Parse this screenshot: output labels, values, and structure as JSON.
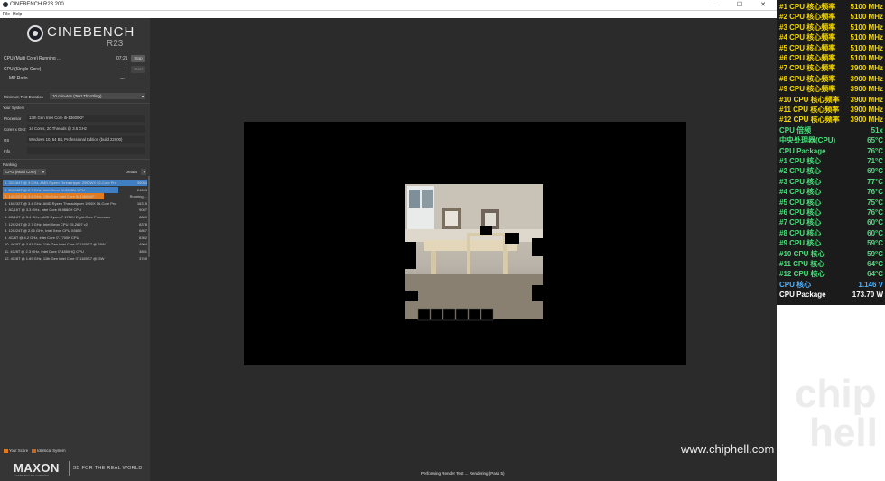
{
  "window": {
    "title": "CINEBENCH R23.200",
    "controls": [
      "—",
      "☐",
      "✕"
    ]
  },
  "menu": [
    "File",
    "Help"
  ],
  "branding": {
    "name": "CINEBENCH",
    "version": "R23"
  },
  "tests": {
    "multi": {
      "label": "CPU (Multi Core)",
      "status": "Running ...",
      "time": "07:21",
      "button": "Stop"
    },
    "single": {
      "label": "CPU (Single Core)",
      "value": "---",
      "button": "Start"
    },
    "mp_ratio": {
      "label": "MP Ratio",
      "value": "---"
    }
  },
  "settings": {
    "min_duration_label": "Minimum Test Duration",
    "min_duration_value": "10 minutes (Test Throttling)"
  },
  "system": {
    "heading": "Your System",
    "fields": [
      {
        "label": "Processor",
        "value": "13th Gen Intel Core i5-13600KF"
      },
      {
        "label": "Cores x GHz",
        "value": "14 Cores, 20 Threads @ 3.5 GHz"
      },
      {
        "label": "OS",
        "value": "Windows 10, 64 Bit, Professional Edition (build 22000)"
      },
      {
        "label": "Info",
        "value": ""
      }
    ]
  },
  "ranking": {
    "heading": "Ranking",
    "selector": "CPU (Multi Core)",
    "details": "Details",
    "rows": [
      {
        "label": "1. 32C/64T @ 3 GHz, AMD Ryzen Threadripper 2990WX 32-Core Pro",
        "score": "30054",
        "fill": 1.0,
        "type": "ref"
      },
      {
        "label": "2. 24C/48T @ 2.7 GHz, Intel Xeon W-3265M CPU",
        "score": "24243",
        "fill": 0.8,
        "type": "ref"
      },
      {
        "label": "3. 14C/20T @ 3.5 GHz, 13th Gen Intel Core i5-13600KF",
        "score": "Running ...",
        "fill": 0.7,
        "type": "yours"
      },
      {
        "label": "4. 16C/32T @ 3.4 GHz, AMD Ryzen Threadripper 1950X 16-Core Pro",
        "score": "16315",
        "fill": 0.0,
        "type": "ref"
      },
      {
        "label": "5. 8C/16T @ 3.3 GHz, Intel Core i9-9880H CPU",
        "score": "9087",
        "fill": 0.0,
        "type": "ref"
      },
      {
        "label": "6. 8C/16T @ 3.4 GHz, AMD Ryzen 7 1700X Eight-Core Processor",
        "score": "8889",
        "fill": 0.0,
        "type": "ref"
      },
      {
        "label": "7. 12C/24T @ 2.7 GHz, Intel Xeon CPU E5-2697 v2",
        "score": "8378",
        "fill": 0.0,
        "type": "ref"
      },
      {
        "label": "8. 12C/24T @ 2.66 GHz, Intel Xeon CPU X5650",
        "score": "6867",
        "fill": 0.0,
        "type": "ref"
      },
      {
        "label": "9. 4C/8T @ 4.2 GHz, Intel Core i7-7700K CPU",
        "score": "6302",
        "fill": 0.0,
        "type": "ref"
      },
      {
        "label": "10. 4C/8T @ 2.81 GHz, 11th Gen Intel Core i7-1165G7 @ 28W",
        "score": "4904",
        "fill": 0.0,
        "type": "ref"
      },
      {
        "label": "11. 4C/8T @ 2.3 GHz, Intel Core i7-4850HQ CPU",
        "score": "3891",
        "fill": 0.0,
        "type": "ref"
      },
      {
        "label": "12. 4C/8T @ 1.69 GHz, 11th Gen Intel Core i7-1165G7 @15W",
        "score": "3769",
        "fill": 0.0,
        "type": "ref"
      }
    ]
  },
  "legend": {
    "your_score": "Your Score",
    "identical": "Identical System"
  },
  "footer": {
    "maxon": "MAXON",
    "maxon_sub": "A NEMETSCHEK COMPANY",
    "tagline": "3D FOR THE REAL WORLD"
  },
  "status": "Performing Render Test ... Rendering (Pass 5)",
  "hwinfo": [
    {
      "k": "#1 CPU 核心频率",
      "v": "5100 MHz",
      "color": "#f5d800"
    },
    {
      "k": "#2 CPU 核心频率",
      "v": "5100 MHz",
      "color": "#f5d800"
    },
    {
      "k": "#3 CPU 核心频率",
      "v": "5100 MHz",
      "color": "#f5d800"
    },
    {
      "k": "#4 CPU 核心频率",
      "v": "5100 MHz",
      "color": "#f5d800"
    },
    {
      "k": "#5 CPU 核心频率",
      "v": "5100 MHz",
      "color": "#f5d800"
    },
    {
      "k": "#6 CPU 核心频率",
      "v": "5100 MHz",
      "color": "#f5d800"
    },
    {
      "k": "#7 CPU 核心频率",
      "v": "3900 MHz",
      "color": "#f5d800"
    },
    {
      "k": "#8 CPU 核心频率",
      "v": "3900 MHz",
      "color": "#f5d800"
    },
    {
      "k": "#9 CPU 核心频率",
      "v": "3900 MHz",
      "color": "#f5d800"
    },
    {
      "k": "#10 CPU 核心频率",
      "v": "3900 MHz",
      "color": "#f5d800"
    },
    {
      "k": "#11 CPU 核心频率",
      "v": "3900 MHz",
      "color": "#f5d800"
    },
    {
      "k": "#12 CPU 核心频率",
      "v": "3900 MHz",
      "color": "#f5d800"
    },
    {
      "k": "CPU 倍频",
      "v": "51x",
      "color": "#48e07a"
    },
    {
      "k": "中央处理器(CPU)",
      "v": "65°C",
      "color": "#48e07a"
    },
    {
      "k": "CPU Package",
      "v": "76°C",
      "color": "#48e07a"
    },
    {
      "k": " #1 CPU 核心",
      "v": "71°C",
      "color": "#48e07a"
    },
    {
      "k": " #2 CPU 核心",
      "v": "69°C",
      "color": "#48e07a"
    },
    {
      "k": " #3 CPU 核心",
      "v": "77°C",
      "color": "#48e07a"
    },
    {
      "k": " #4 CPU 核心",
      "v": "76°C",
      "color": "#48e07a"
    },
    {
      "k": " #5 CPU 核心",
      "v": "75°C",
      "color": "#48e07a"
    },
    {
      "k": " #6 CPU 核心",
      "v": "76°C",
      "color": "#48e07a"
    },
    {
      "k": " #7 CPU 核心",
      "v": "60°C",
      "color": "#48e07a"
    },
    {
      "k": " #8 CPU 核心",
      "v": "60°C",
      "color": "#48e07a"
    },
    {
      "k": " #9 CPU 核心",
      "v": "59°C",
      "color": "#48e07a"
    },
    {
      "k": " #10 CPU 核心",
      "v": "59°C",
      "color": "#48e07a"
    },
    {
      "k": " #11 CPU 核心",
      "v": "64°C",
      "color": "#48e07a"
    },
    {
      "k": " #12 CPU 核心",
      "v": "64°C",
      "color": "#48e07a"
    },
    {
      "k": "CPU 核心",
      "v": "1.146 V",
      "color": "#4fb2ff"
    },
    {
      "k": "CPU Package",
      "v": "173.70 W",
      "color": "#ffffff"
    }
  ],
  "watermark": {
    "site": "www.chiphell.com",
    "chip": "chip",
    "hell": "hell"
  },
  "colors": {
    "your_score": "#e07b20",
    "identical": "#c06a2a",
    "ref_bar": "#3f7fc2",
    "panel": "#353535"
  }
}
